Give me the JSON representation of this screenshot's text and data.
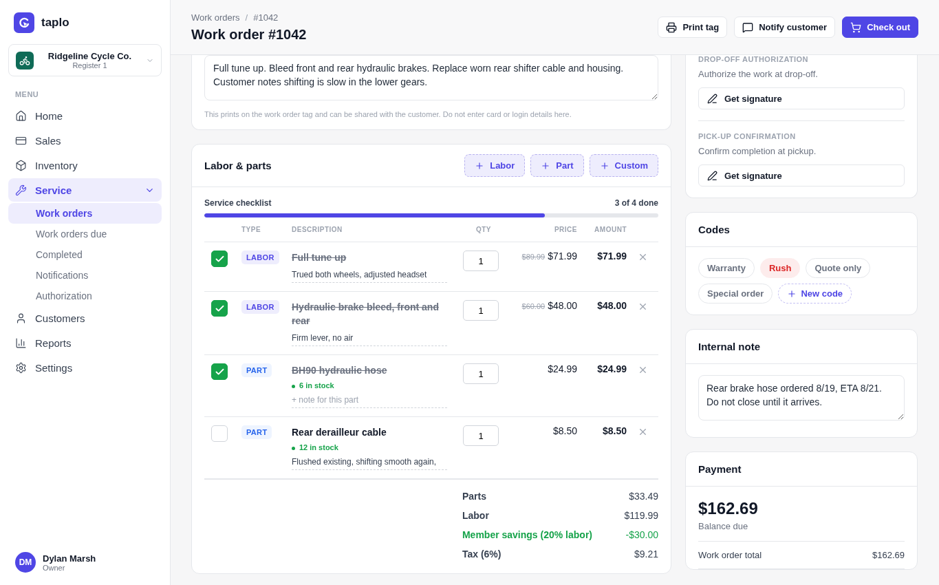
{
  "brand": {
    "name": "taplo"
  },
  "store": {
    "name": "Ridgeline Cycle Co.",
    "register": "Register 1"
  },
  "menu_label": "MENU",
  "nav": [
    {
      "label": "Home",
      "selected": false
    },
    {
      "label": "Sales",
      "selected": false
    },
    {
      "label": "Inventory",
      "selected": false
    },
    {
      "label": "Service",
      "selected": true,
      "expanded": true,
      "children": [
        {
          "label": "Work orders",
          "selected": true
        },
        {
          "label": "Work orders due",
          "selected": false
        },
        {
          "label": "Completed",
          "selected": false
        },
        {
          "label": "Notifications",
          "selected": false
        },
        {
          "label": "Authorization",
          "selected": false
        }
      ]
    },
    {
      "label": "Customers",
      "selected": false
    },
    {
      "label": "Reports",
      "selected": false
    },
    {
      "label": "Settings",
      "selected": false
    }
  ],
  "user": {
    "initials": "DM",
    "name": "Dylan Marsh",
    "role": "Owner"
  },
  "breadcrumb": [
    "Work orders",
    "#1042"
  ],
  "breadcrumb_separator": "/",
  "title": "Work order #1042",
  "actions": [
    {
      "label": "Print tag",
      "primary": false
    },
    {
      "label": "Notify customer",
      "primary": false
    },
    {
      "label": "Check out",
      "primary": true
    }
  ],
  "notes": {
    "value": "Full tune up. Bleed front and rear hydraulic brakes. Replace worn rear shifter cable and housing. Customer notes shifting is slow in the lower gears.",
    "help": "This prints on the work order tag and can be shared with the customer. Do not enter card or login details here."
  },
  "labor_parts": {
    "title": "Labor & parts",
    "add_buttons": [
      "Labor",
      "Part",
      "Custom"
    ],
    "checklist": {
      "label": "Service checklist",
      "count": "3 of 4 done",
      "level": 0.75
    },
    "columns": [
      "TYPE",
      "DESCRIPTION",
      "QTY",
      "PRICE",
      "AMOUNT"
    ],
    "rows": [
      {
        "kind": "labor",
        "type": "LABOR",
        "checked": true,
        "title": "Full tune up",
        "note": "Trued both wheels, adjusted headset",
        "qty": "1",
        "old_price": "$89.99",
        "price": "$71.99",
        "amount": "$71.99"
      },
      {
        "kind": "labor",
        "type": "LABOR",
        "checked": true,
        "title": "Hydraulic brake bleed, front and rear",
        "note": "Firm lever, no air",
        "qty": "1",
        "old_price": "$60.00",
        "price": "$48.00",
        "amount": "$48.00"
      },
      {
        "kind": "part",
        "type": "PART",
        "checked": true,
        "title": "BH90 hydraulic hose",
        "stock": "6 in stock",
        "note_placeholder": "+ note for this part",
        "qty": "1",
        "price": "$24.99",
        "amount": "$24.99"
      },
      {
        "kind": "part",
        "type": "PART",
        "checked": false,
        "title": "Rear derailleur cable",
        "stock": "12 in stock",
        "note": "Flushed existing, shifting smooth again,",
        "qty": "1",
        "price": "$8.50",
        "amount": "$8.50"
      }
    ],
    "summary": [
      {
        "kind": "normal",
        "label": "Parts",
        "value": "$33.49"
      },
      {
        "kind": "normal",
        "label": "Labor",
        "value": "$119.99"
      },
      {
        "kind": "savings",
        "label": "Member savings (20% labor)",
        "value": "-$30.00"
      },
      {
        "kind": "normal",
        "label": "Tax (6%)",
        "value": "$9.21"
      }
    ]
  },
  "signatures": [
    {
      "heading": "DROP-OFF AUTHORIZATION",
      "text": "Authorize the work at drop-off.",
      "button": "Get signature"
    },
    {
      "heading": "PICK-UP CONFIRMATION",
      "text": "Confirm completion at pickup.",
      "button": "Get signature"
    }
  ],
  "codes": {
    "title": "Codes",
    "items": [
      {
        "label": "Warranty",
        "selected": false
      },
      {
        "label": "Rush",
        "selected": true
      },
      {
        "label": "Quote only",
        "selected": false
      },
      {
        "label": "Special order",
        "selected": false
      }
    ],
    "new_button": "New code"
  },
  "internal_note": {
    "title": "Internal note",
    "value": "Rear brake hose ordered 8/19, ETA 8/21. Do not close until it arrives."
  },
  "payment": {
    "title": "Payment",
    "amount": "$162.69",
    "caption": "Balance due",
    "rows": [
      {
        "label": "Work order total",
        "value": "$162.69"
      }
    ]
  }
}
